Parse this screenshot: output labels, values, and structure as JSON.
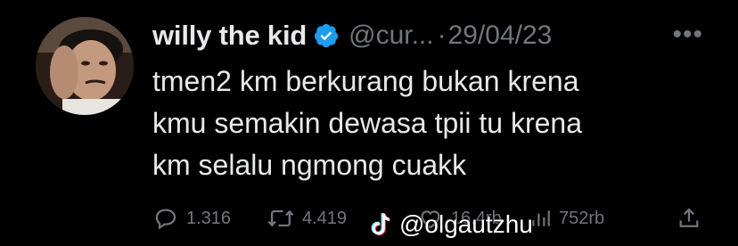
{
  "tweet": {
    "display_name": "willy the kid",
    "handle": "@cur...",
    "separator": "·",
    "date": "29/04/23",
    "more_label": "•••",
    "text": "tmen2 km berkurang bukan krena\nkmu semakin dewasa tpii tu krena\nkm selalu ngmong cuakk"
  },
  "actions": {
    "replies": "1.316",
    "retweets": "4.419",
    "likes": "16.4rb",
    "views": "752rb"
  },
  "watermark": {
    "text": "@olgautzhu"
  },
  "colors": {
    "background": "#000000",
    "text": "#e7e9ea",
    "secondary": "#71767b",
    "verified": "#1d9bf0"
  },
  "icons": [
    "verified-badge-icon",
    "more-icon",
    "reply-icon",
    "retweet-icon",
    "like-icon",
    "views-icon",
    "share-icon",
    "tiktok-icon"
  ]
}
